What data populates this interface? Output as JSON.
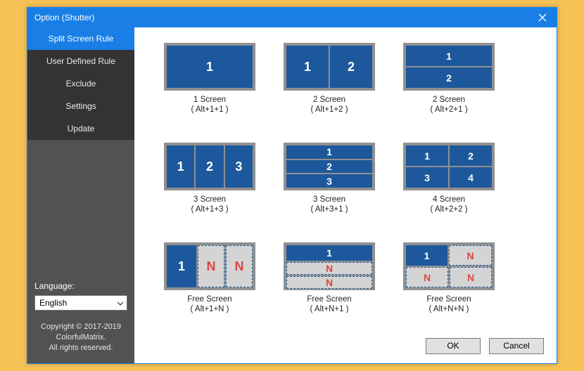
{
  "window": {
    "title": "Option (Shutter)"
  },
  "sidebar": {
    "items": [
      {
        "label": "Split Screen Rule",
        "name": "nav-split-screen-rule",
        "active": true
      },
      {
        "label": "User Defined Rule",
        "name": "nav-user-defined-rule",
        "active": false
      },
      {
        "label": "Exclude",
        "name": "nav-exclude",
        "active": false
      },
      {
        "label": "Settings",
        "name": "nav-settings",
        "active": false
      },
      {
        "label": "Update",
        "name": "nav-update",
        "active": false
      }
    ]
  },
  "language": {
    "label": "Language:",
    "selected": "English"
  },
  "copyright": {
    "line1": "Copyright © 2017-2019",
    "line2": "ColorfulMatrix.",
    "line3": "All rights reserved."
  },
  "rules": [
    {
      "title": "1 Screen",
      "shortcut": "( Alt+1+1 )"
    },
    {
      "title": "2 Screen",
      "shortcut": "( Alt+1+2 )"
    },
    {
      "title": "2 Screen",
      "shortcut": "( Alt+2+1 )"
    },
    {
      "title": "3 Screen",
      "shortcut": "( Alt+1+3 )"
    },
    {
      "title": "3 Screen",
      "shortcut": "( Alt+3+1 )"
    },
    {
      "title": "4 Screen",
      "shortcut": "( Alt+2+2 )"
    },
    {
      "title": "Free Screen",
      "shortcut": "( Alt+1+N )"
    },
    {
      "title": "Free Screen",
      "shortcut": "( Alt+N+1 )"
    },
    {
      "title": "Free Screen",
      "shortcut": "( Alt+N+N )"
    }
  ],
  "buttons": {
    "ok": "OK",
    "cancel": "Cancel"
  }
}
